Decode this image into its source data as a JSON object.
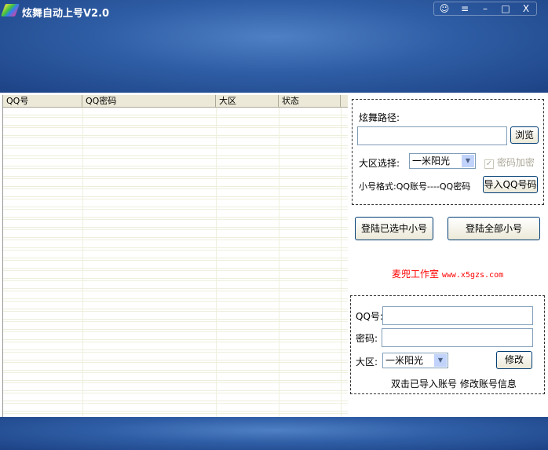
{
  "window": {
    "title": "炫舞自动上号V2.0",
    "controls": [
      "☺",
      "≡",
      "–",
      "□",
      "X"
    ]
  },
  "table": {
    "columns": [
      "QQ号",
      "QQ密码",
      "大区",
      "状态"
    ]
  },
  "settings": {
    "path_label": "炫舞路径:",
    "path_value": "",
    "browse_label": "浏览",
    "region_label": "大区选择:",
    "region_value": "一米阳光",
    "encrypt_label": "密码加密",
    "encrypt_checked": true,
    "format_label": "小号格式:QQ账号----QQ密码",
    "import_label": "导入QQ号码"
  },
  "actions": {
    "login_selected": "登陆已选中小号",
    "login_all": "登陆全部小号"
  },
  "credit": {
    "studio": "麦兜工作室",
    "url": "www.x5gzs.com"
  },
  "edit": {
    "qq_label": "QQ号:",
    "qq_value": "",
    "pwd_label": "密码:",
    "pwd_value": "",
    "region_label": "大区:",
    "region_value": "一米阳光",
    "modify_label": "修改",
    "hint": "双击已导入账号 修改账号信息"
  }
}
